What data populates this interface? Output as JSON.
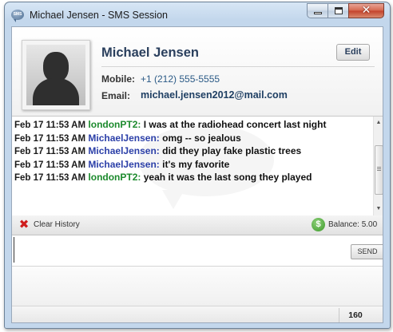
{
  "window": {
    "title": "Michael Jensen - SMS Session",
    "app_icon_text": "SMS",
    "close_glyph": "✕"
  },
  "contact": {
    "name": "Michael Jensen",
    "edit_label": "Edit",
    "mobile_label": "Mobile:",
    "mobile_value": "+1 (212) 555-5555",
    "email_label": "Email:",
    "email_value": "michael.jensen2012@mail.com"
  },
  "messages": [
    {
      "time": "Feb 17 11:53 AM",
      "sender": "londonPT2:",
      "text": "I was at the radiohead concert last night",
      "sender_color": "#1c8a2d"
    },
    {
      "time": "Feb 17 11:53 AM",
      "sender": "MichaelJensen:",
      "text": "omg -- so jealous",
      "sender_color": "#2b3fa8"
    },
    {
      "time": "Feb 17 11:53 AM",
      "sender": "MichaelJensen:",
      "text": "did they play fake plastic trees",
      "sender_color": "#2b3fa8"
    },
    {
      "time": "Feb 17 11:53 AM",
      "sender": "MichaelJensen:",
      "text": "it's my favorite",
      "sender_color": "#2b3fa8"
    },
    {
      "time": "Feb 17 11:53 AM",
      "sender": "londonPT2:",
      "text": "yeah it was the last song they played",
      "sender_color": "#1c8a2d"
    }
  ],
  "toolbar": {
    "clear_history_label": "Clear History",
    "clear_icon_glyph": "✖",
    "balance_icon_glyph": "$",
    "balance_label": "Balance: 5.00"
  },
  "composer": {
    "value": "",
    "send_label": "SEND"
  },
  "footer": {
    "char_count": "160"
  },
  "colors": {
    "contact_name": "#2a3f5d",
    "other_sender": "#1c8a2d",
    "self_sender": "#2b3fa8",
    "clear_icon": "#cf1d1d",
    "balance_icon": "#3c9a2a"
  }
}
